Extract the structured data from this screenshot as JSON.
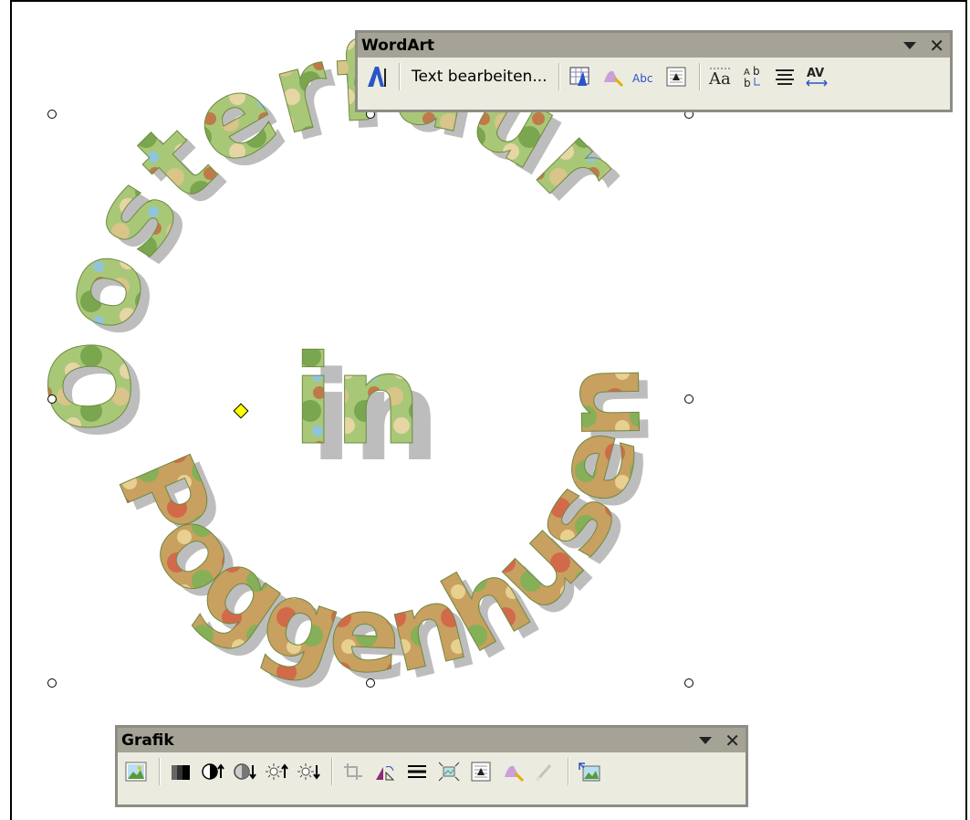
{
  "wordart_toolbar": {
    "title": "WordArt",
    "edit_text_label": "Text bearbeiten...",
    "buttons": [
      {
        "name": "insert-wordart-icon"
      },
      {
        "name": "wordart-gallery-icon"
      },
      {
        "name": "format-wordart-icon"
      },
      {
        "name": "wordart-shape-icon"
      },
      {
        "name": "text-wrapping-icon"
      },
      {
        "name": "same-letter-heights-icon"
      },
      {
        "name": "vertical-text-icon"
      },
      {
        "name": "alignment-icon"
      },
      {
        "name": "character-spacing-icon"
      }
    ]
  },
  "grafik_toolbar": {
    "title": "Grafik",
    "buttons": [
      {
        "name": "insert-picture-icon"
      },
      {
        "name": "color-icon"
      },
      {
        "name": "more-contrast-icon"
      },
      {
        "name": "less-contrast-icon"
      },
      {
        "name": "more-brightness-icon"
      },
      {
        "name": "less-brightness-icon"
      },
      {
        "name": "crop-icon"
      },
      {
        "name": "rotate-left-icon"
      },
      {
        "name": "line-style-icon"
      },
      {
        "name": "compress-pictures-icon"
      },
      {
        "name": "text-wrapping-icon"
      },
      {
        "name": "format-picture-icon"
      },
      {
        "name": "set-transparent-color-icon"
      },
      {
        "name": "reset-picture-icon"
      }
    ]
  },
  "wordart": {
    "outer_text": "Oosterfüür",
    "inner_text": "in",
    "lower_text": "Poggenhusen!",
    "colors": {
      "fill_green": "#8bb060",
      "fill_blue": "#9fd2e6",
      "fill_orange": "#d98a4a",
      "shadow": "#b8b8b8"
    }
  }
}
